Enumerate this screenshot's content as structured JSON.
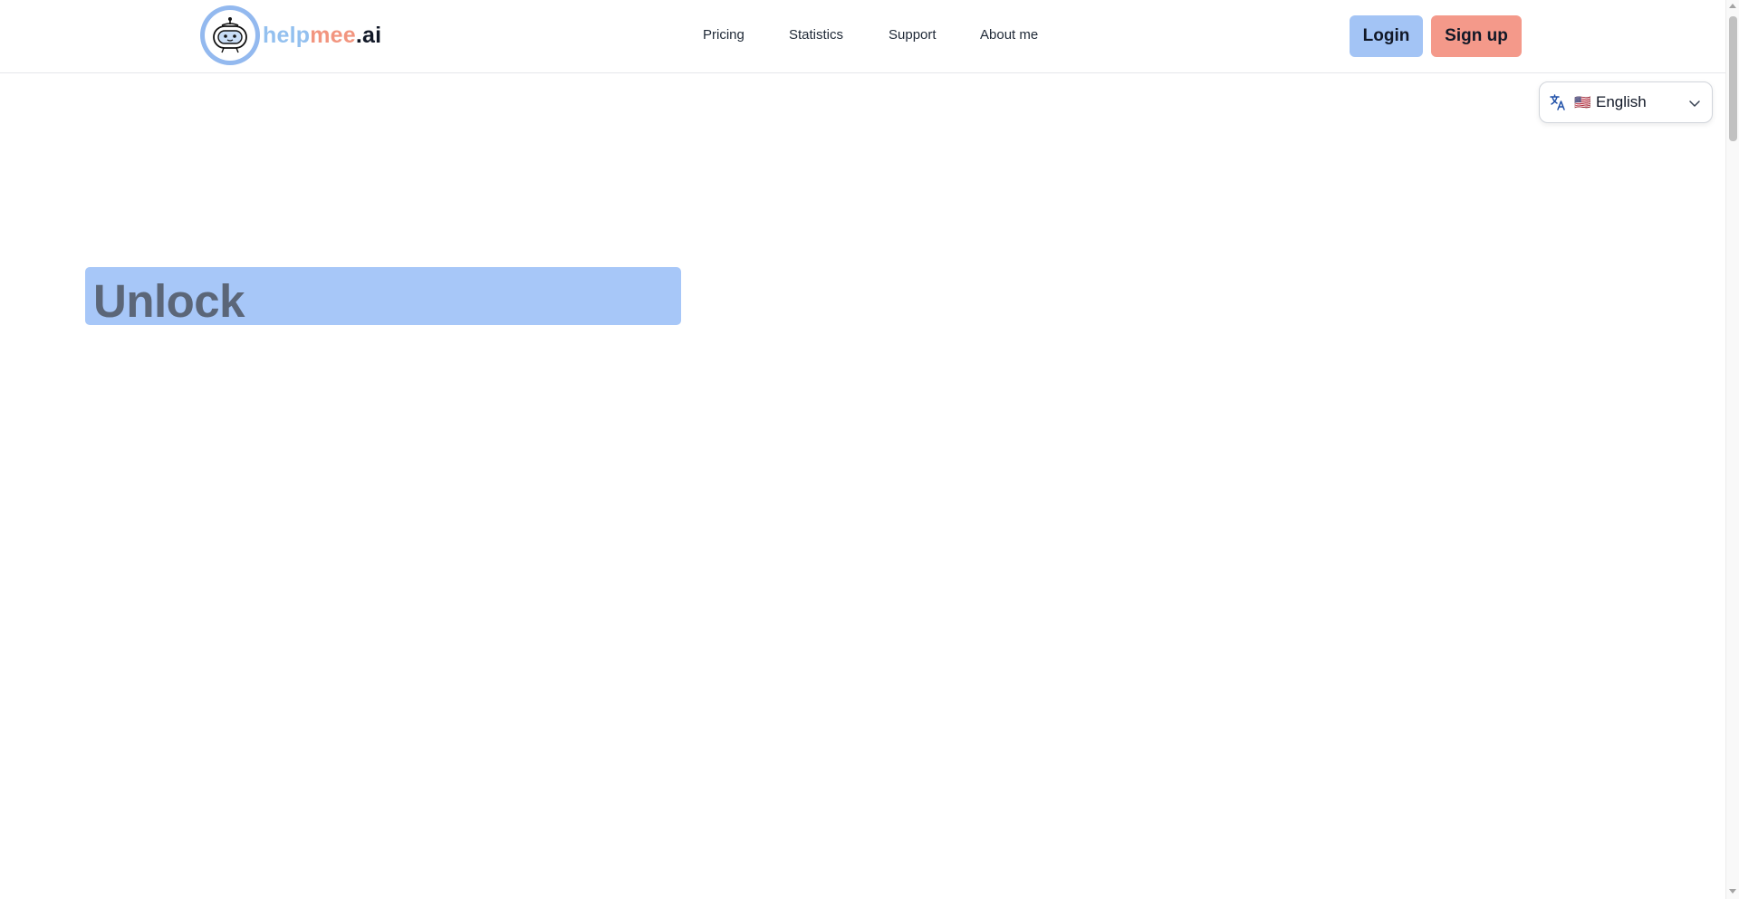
{
  "brand": {
    "part1": "help",
    "part2": "mee",
    "part3": ".ai",
    "logo_icon": "robot-face-icon",
    "colors": {
      "part1": "#93c0ef",
      "part2": "#f2957f",
      "part3": "#111827"
    }
  },
  "nav": {
    "items": [
      {
        "label": "Pricing"
      },
      {
        "label": "Statistics"
      },
      {
        "label": "Support"
      },
      {
        "label": "About me"
      }
    ]
  },
  "auth": {
    "login_label": "Login",
    "signup_label": "Sign up",
    "login_color": "#a3c4f5",
    "signup_color": "#f4998a"
  },
  "language": {
    "icon": "translate-icon",
    "flag": "🇺🇸",
    "selected": "English",
    "chevron": "chevron-down-icon"
  },
  "hero": {
    "headline": "Unlock",
    "highlight_color": "#a7c7f8"
  }
}
